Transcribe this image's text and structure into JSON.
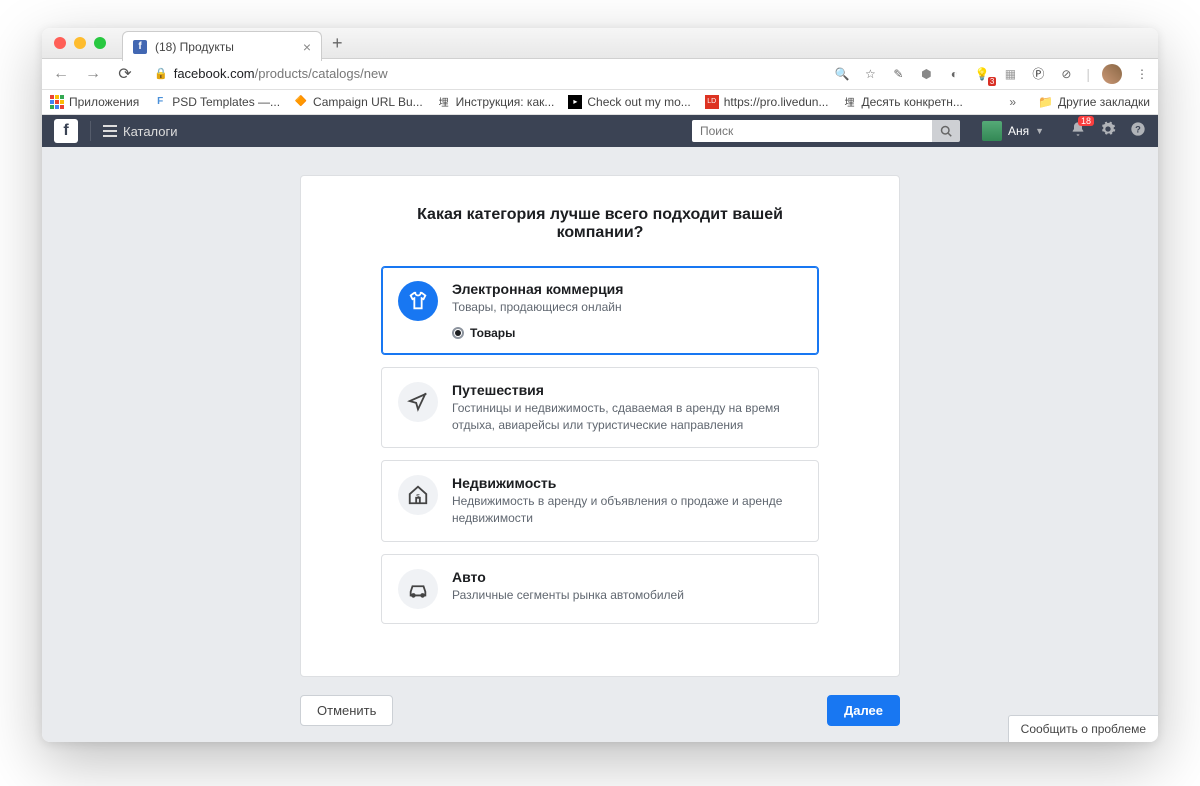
{
  "browser": {
    "tab_title": "(18) Продукты",
    "url_host": "facebook.com",
    "url_path": "/products/catalogs/new",
    "new_tab_glyph": "+"
  },
  "bookmarks": {
    "apps": "Приложения",
    "items": [
      {
        "icon": "F",
        "color": "#4a90d9",
        "label": "PSD Templates —..."
      },
      {
        "icon": "◆",
        "color": "#f7a800",
        "label": "Campaign URL Bu..."
      },
      {
        "icon": "埋",
        "color": "#666",
        "label": "Инструкция: как..."
      },
      {
        "icon": "■",
        "color": "#000",
        "label": "Check out my mo..."
      },
      {
        "icon": "LD",
        "color": "#d32",
        "label": "https://pro.livedun..."
      },
      {
        "icon": "埋",
        "color": "#666",
        "label": "Десять конкретн..."
      }
    ],
    "more": "»",
    "other": "Другие закладки"
  },
  "fb_header": {
    "section": "Каталоги",
    "search_placeholder": "Поиск",
    "user_name": "Аня",
    "notif_count": "18"
  },
  "card": {
    "title": "Какая категория лучше всего подходит вашей компании?",
    "options": [
      {
        "key": "ecommerce",
        "title": "Электронная коммерция",
        "desc": "Товары, продающиеся онлайн",
        "selected": true,
        "radio_label": "Товары"
      },
      {
        "key": "travel",
        "title": "Путешествия",
        "desc": "Гостиницы и недвижимость, сдаваемая в аренду на время отдыха, авиарейсы или туристические направления"
      },
      {
        "key": "realestate",
        "title": "Недвижимость",
        "desc": "Недвижимость в аренду и объявления о продаже и аренде недвижимости"
      },
      {
        "key": "auto",
        "title": "Авто",
        "desc": "Различные сегменты рынка автомобилей"
      }
    ]
  },
  "footer": {
    "cancel": "Отменить",
    "next": "Далее"
  },
  "report_problem": "Сообщить о проблеме"
}
